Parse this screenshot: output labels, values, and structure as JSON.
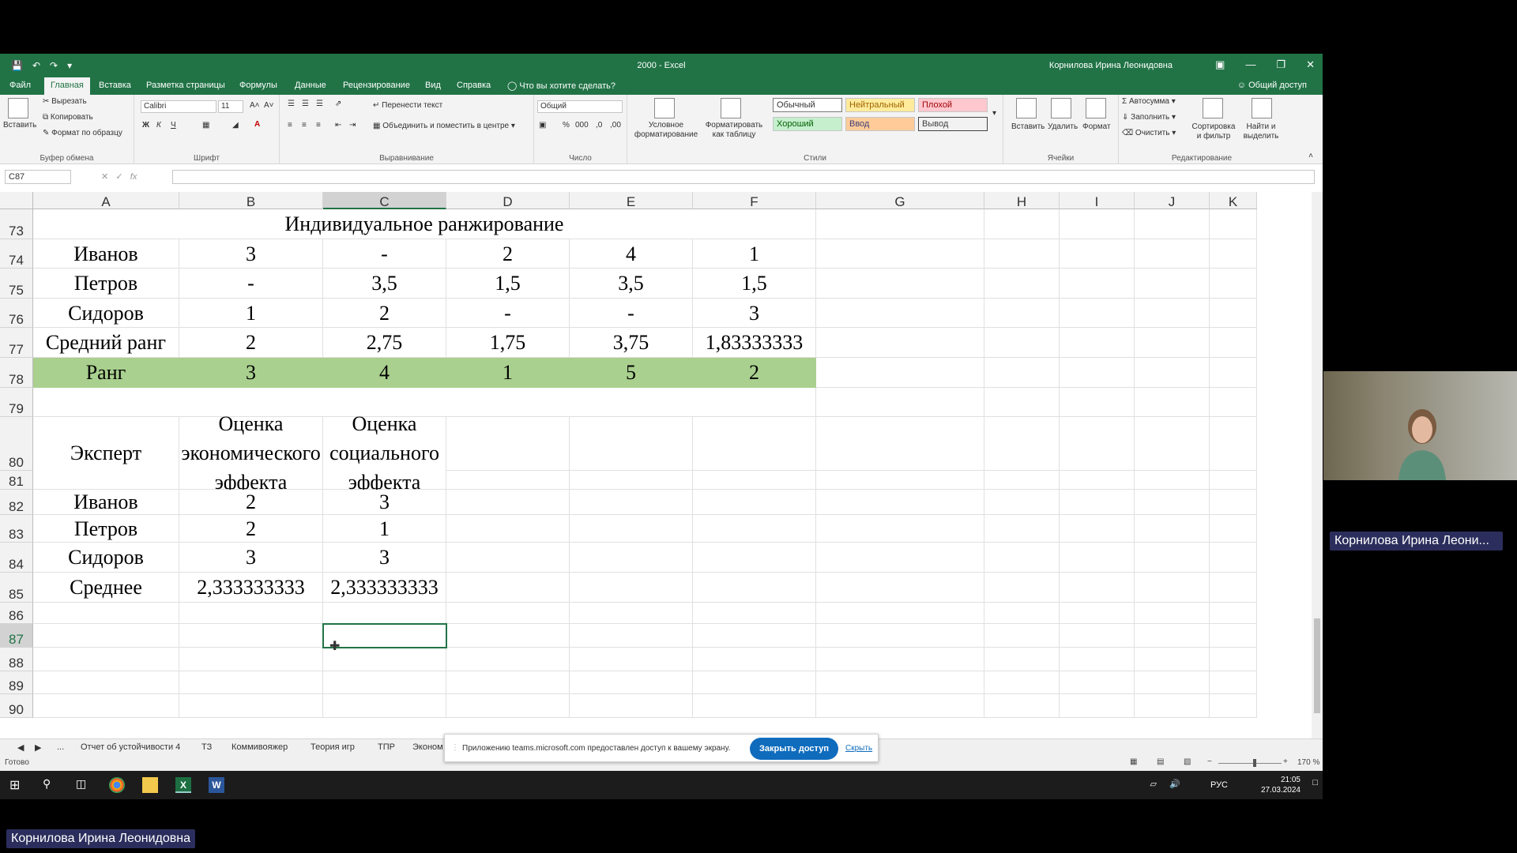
{
  "window": {
    "title": "2000  -  Excel",
    "user": "Корнилова Ирина Леонидовна",
    "accent": "#217346"
  },
  "ribbon_tabs": [
    "Файл",
    "Главная",
    "Вставка",
    "Разметка страницы",
    "Формулы",
    "Данные",
    "Рецензирование",
    "Вид",
    "Справка",
    "Что вы хотите сделать?"
  ],
  "share_label": "Общий доступ",
  "ribbon": {
    "clipboard": {
      "paste": "Вставить",
      "cut": "Вырезать",
      "copy": "Копировать",
      "format_painter": "Формат по образцу",
      "label": "Буфер обмена"
    },
    "font": {
      "name": "Calibri",
      "size": "11",
      "bold": "Ж",
      "italic": "К",
      "underline": "Ч",
      "label": "Шрифт"
    },
    "alignment": {
      "wrap": "Перенести текст",
      "merge": "Объединить и поместить в центре",
      "label": "Выравнивание"
    },
    "number": {
      "format": "Общий",
      "label": "Число"
    },
    "styles": {
      "conditional": "Условное форматирование",
      "as_table": "Форматировать как таблицу",
      "normal": "Обычный",
      "neutral": "Нейтральный",
      "bad": "Плохой",
      "good": "Хороший",
      "input": "Ввод",
      "output": "Вывод",
      "label": "Стили"
    },
    "cells": {
      "insert": "Вставить",
      "delete": "Удалить",
      "format": "Формат",
      "label": "Ячейки"
    },
    "editing": {
      "autosum": "Автосумма",
      "fill": "Заполнить",
      "clear": "Очистить",
      "sort": "Сортировка и фильтр",
      "find": "Найти и выделить",
      "label": "Редактирование"
    }
  },
  "formula_bar": {
    "name_box": "C87",
    "fx": "fx",
    "value": ""
  },
  "columns": [
    "A",
    "B",
    "C",
    "D",
    "E",
    "F",
    "G",
    "H",
    "I",
    "J",
    "K"
  ],
  "selected_column": "C",
  "rows": [
    "73",
    "74",
    "75",
    "76",
    "77",
    "78",
    "79",
    "80",
    "81",
    "82",
    "83",
    "84",
    "85",
    "86",
    "87",
    "88",
    "89",
    "90"
  ],
  "sheet": {
    "ranking_title": "Индивидуальное ранжирование",
    "ranking_rows": [
      {
        "label": "Иванов",
        "values": [
          "3",
          "-",
          "2",
          "4",
          "1"
        ]
      },
      {
        "label": "Петров",
        "values": [
          "-",
          "3,5",
          "1,5",
          "3,5",
          "1,5"
        ]
      },
      {
        "label": "Сидоров",
        "values": [
          "1",
          "2",
          "-",
          "-",
          "3"
        ]
      },
      {
        "label": "Средний ранг",
        "values": [
          "2",
          "2,75",
          "1,75",
          "3,75",
          "1,83333333"
        ]
      },
      {
        "label": "Ранг",
        "values": [
          "3",
          "4",
          "1",
          "5",
          "2"
        ]
      }
    ],
    "eval_headers": [
      "Эксперт",
      "Оценка экономического эффекта",
      "Оценка социального эффекта"
    ],
    "eval_rows": [
      {
        "label": "Иванов",
        "values": [
          "2",
          "3"
        ]
      },
      {
        "label": "Петров",
        "values": [
          "2",
          "1"
        ]
      },
      {
        "label": "Сидоров",
        "values": [
          "3",
          "3"
        ]
      },
      {
        "label": "Среднее",
        "values": [
          "2,333333333",
          "2,333333333"
        ]
      }
    ],
    "rank_highlight": "#a9d08e"
  },
  "sheet_tabs": [
    "...",
    "Отчет об устойчивости 4",
    "ТЗ",
    "Коммивояжер",
    "Теория игр",
    "ТПР",
    "Эконом"
  ],
  "status": {
    "ready": "Готово",
    "zoom": "170 %"
  },
  "share_notice": {
    "message": "Приложению teams.microsoft.com предоставлен доступ к вашему экрану.",
    "stop": "Закрыть доступ",
    "hide": "Скрыть"
  },
  "taskbar": {
    "lang": "РУС",
    "time": "21:05",
    "date": "27.03.2024"
  },
  "video_name": "Корнилова Ирина Леони...",
  "bottom_name": "Корнилова Ирина Леонидовна"
}
